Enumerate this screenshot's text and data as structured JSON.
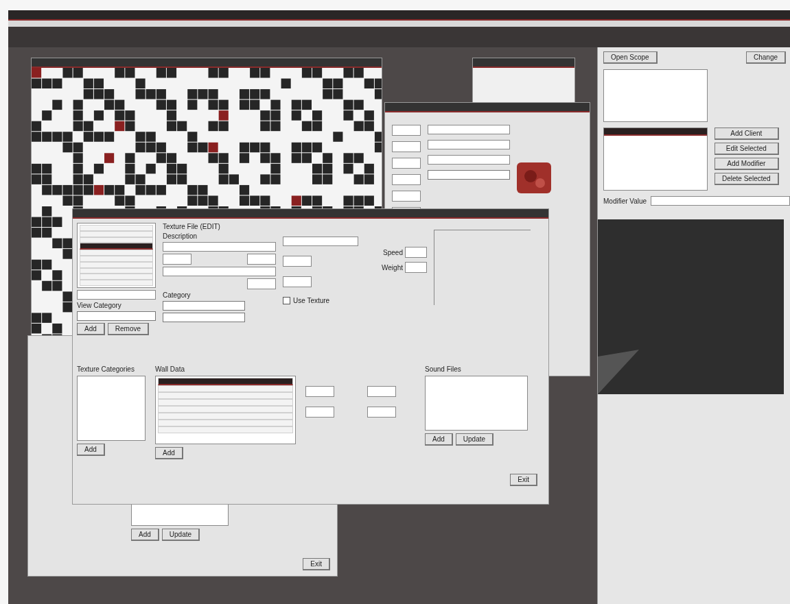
{
  "dialog": {
    "texture_list": {
      "rows": [
        {
          "selected": false
        },
        {
          "selected": false
        },
        {
          "selected": false
        },
        {
          "selected": true
        },
        {
          "selected": false
        },
        {
          "selected": false
        },
        {
          "selected": false
        },
        {
          "selected": false
        },
        {
          "selected": false
        },
        {
          "selected": false
        }
      ]
    },
    "view_category_label": "View Category",
    "list_buttons": [
      "Add",
      "Remove"
    ],
    "section_label": "Texture File (EDIT)",
    "description_label": "Description",
    "category_label": "Category",
    "use_texture": {
      "label": "Use Texture",
      "checked": false
    },
    "stats": [
      {
        "label": "Speed"
      },
      {
        "label": "Weight"
      }
    ],
    "texture_categories": {
      "title": "Texture Categories",
      "button": "Add"
    },
    "wall_data": {
      "title": "Wall Data",
      "rows": [
        {
          "selected": true
        },
        {
          "selected": false
        },
        {
          "selected": false
        },
        {
          "selected": false
        },
        {
          "selected": false
        },
        {
          "selected": false
        },
        {
          "selected": false
        },
        {
          "selected": false
        }
      ],
      "button": "Add"
    },
    "sound_files": {
      "title": "Sound Files",
      "buttons": [
        "Add",
        "Update"
      ]
    },
    "exit": "Exit"
  },
  "right_panel": {
    "open_button": "Open Scope",
    "change_button": "Change",
    "actions": [
      "Add Client",
      "Edit Selected",
      "Add Modifier",
      "Delete Selected"
    ],
    "modifier_label": "Modifier Value"
  },
  "back_window": {
    "buttons": [
      "Add",
      "Update"
    ],
    "exit": "Exit"
  }
}
